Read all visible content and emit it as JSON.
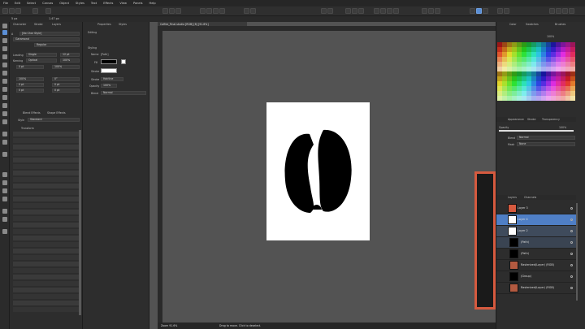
{
  "menubar": {
    "items": [
      "File",
      "Edit",
      "Select",
      "Canvas",
      "Object",
      "Styles",
      "Text",
      "Effects",
      "View",
      "Panels",
      "Help"
    ]
  },
  "context": {
    "snap_label": "5 px",
    "pos_x": "1.47 px"
  },
  "document_tab": {
    "title": "Coffee_Final.studio [RGB] [8] [91.6%]"
  },
  "left_panel": {
    "tabs": [
      "Character",
      "Stroke",
      "Layers"
    ],
    "char_style": "[No Char Style]",
    "font_family": "Garamond",
    "font_style": "Regular",
    "leading": "Leading",
    "leading_value": "Single",
    "leading_size": "12 pt",
    "kerning": "Kerning",
    "kerning_value": "Optical",
    "tracking_value": "100%",
    "baseline": "0 pt",
    "scale_x": "100%",
    "scale_y": "100%",
    "shear": "0°",
    "spacing": "0 pt",
    "panel2_tabs": [
      "Blend Effects",
      "Shape Effects"
    ],
    "style_label": "Style",
    "style_value": "Standard",
    "transform_label": "Transform"
  },
  "props_panel": {
    "tabs": [
      "Properties",
      "Styles"
    ],
    "section_fill": "Editing",
    "name_label": "Name",
    "name_value": "[Path]",
    "section_styling": "Styling",
    "fill_label": "Fill",
    "stroke_label": "Stroke",
    "stroke_width_label": "Stroke",
    "stroke_width_value": "Hairline",
    "opacity_label": "Opacity",
    "opacity_value": "100%",
    "blend_label": "Blend",
    "blend_value": "Normal",
    "colors": {
      "fill": "#000000",
      "stroke": "#ffffff"
    }
  },
  "right_panel": {
    "tabs_top": [
      "Color",
      "Swatches",
      "Brushes"
    ],
    "opacity_readout": "100%",
    "tabs_mid": [
      "Appearance",
      "Stroke",
      "Transparency"
    ],
    "opacity_label": "Opacity",
    "opacity_value": "100%",
    "blend_label": "Blend",
    "blend_value": "Normal",
    "mask_label": "Mask",
    "mask_value": "None",
    "tabs_layers": [
      "Layers",
      "Channels"
    ],
    "layers": [
      {
        "name": "Layer 3"
      },
      {
        "name": "Layer 4"
      },
      {
        "name": "Layer 2"
      },
      {
        "name": "(Path)"
      },
      {
        "name": "(Path)"
      },
      {
        "name": "Rasterized(Layer) (RGB)"
      },
      {
        "name": "(Group)"
      },
      {
        "name": "Rasterized(Layer) (RGB)"
      }
    ]
  },
  "status": {
    "zoom": "Zoom 91.6%",
    "hint": "Drag to move. Click to deselect."
  },
  "icons": {
    "move": "move-tool-icon",
    "pen": "pen-tool-icon"
  }
}
